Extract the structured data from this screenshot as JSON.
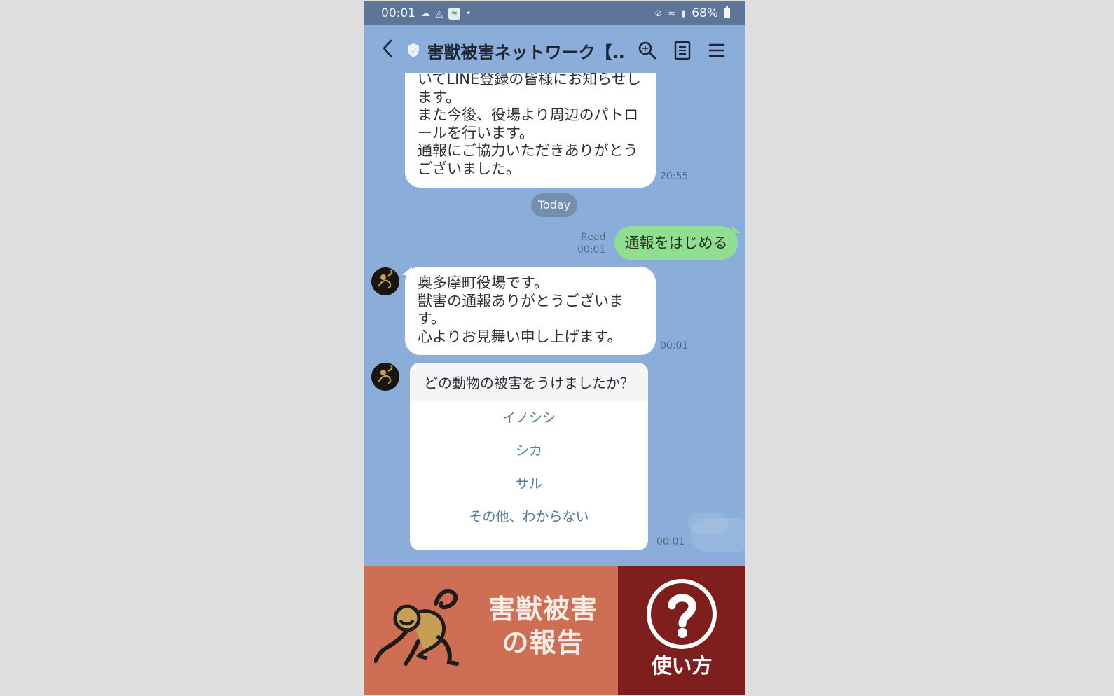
{
  "status_bar": {
    "time": "00:01",
    "battery": "68%"
  },
  "header": {
    "title": "害獣被害ネットワーク【..."
  },
  "messages": {
    "first_text": "いてLINE登録の皆様にお知らせします。\nまた今後、役場より周辺のパトロールを行います。\n通報にご協力いただきありがとうございました。",
    "first_time": "20:55",
    "today": "Today",
    "sent_text": "通報をはじめる",
    "read_label": "Read",
    "sent_time": "00:01",
    "second_text": "奥多摩町役場です。\n獣害の通報ありがとうございます。\n心よりお見舞い申し上げます。",
    "second_time": "00:01",
    "question": "どの動物の被害をうけましたか？",
    "options": [
      "イノシシ",
      "シカ",
      "サル",
      "その他、わからない"
    ],
    "question_time": "00:01"
  },
  "rich_menu": {
    "report_label_line1": "害獣被害",
    "report_label_line2": "の報告",
    "help_label": "使い方"
  },
  "colors": {
    "chat_background": "#8aaed9",
    "status_bar": "#5d7599",
    "sent_bubble": "#90de8f",
    "report_button": "#ce6f55",
    "help_button": "#7e1f1d"
  },
  "icons": {
    "back": "back-icon",
    "verified": "shield-icon",
    "search": "search-icon",
    "notes": "notes-icon",
    "menu": "menu-icon",
    "avatar": "monkey-icon",
    "help": "question-icon"
  }
}
